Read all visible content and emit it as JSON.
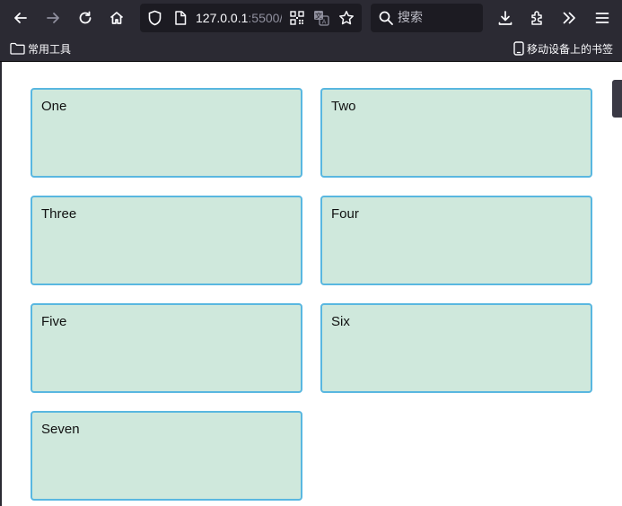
{
  "browser": {
    "url_host": "127.0.0.1",
    "url_port": ":5500/",
    "search_placeholder": "搜索",
    "bookmark_left": "常用工具",
    "bookmark_right": "移动设备上的书签"
  },
  "boxes": [
    "One",
    "Two",
    "Three",
    "Four",
    "Five",
    "Six",
    "Seven"
  ],
  "colors": {
    "chrome": "#2b2a33",
    "box_fill": "#cfe8dc",
    "box_border": "#59b7e0"
  }
}
